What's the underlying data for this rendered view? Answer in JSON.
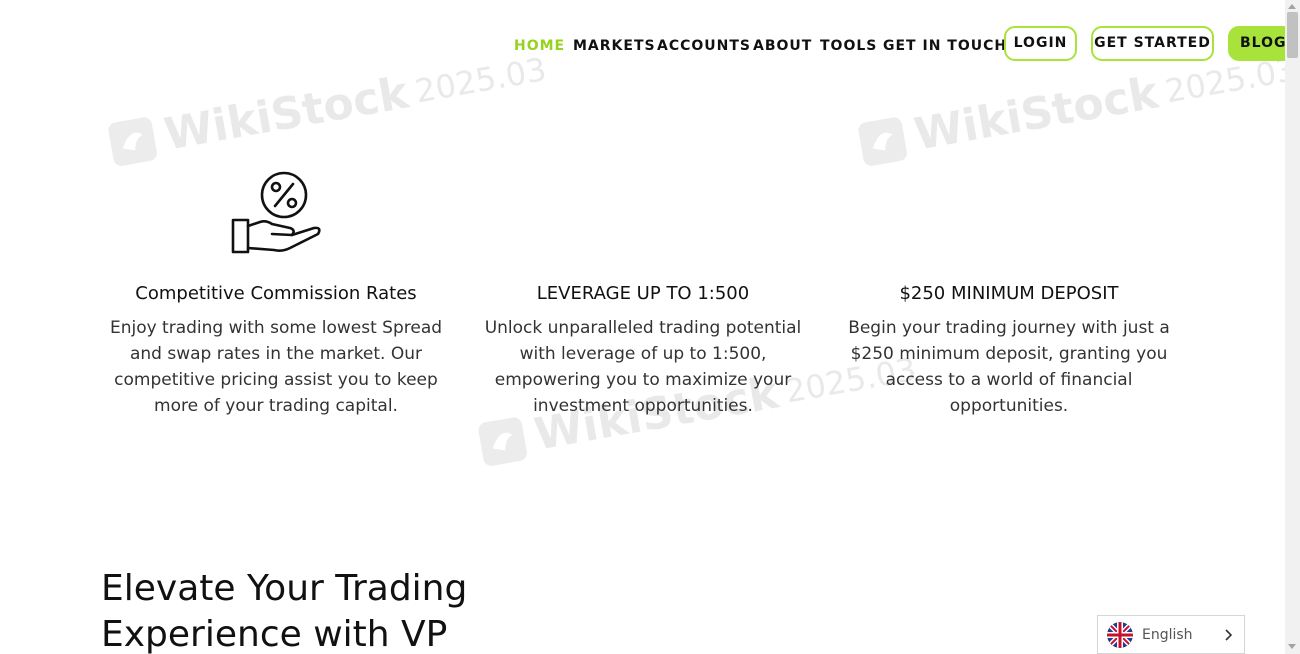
{
  "nav": {
    "links": [
      "HOME",
      "MARKETS",
      "ACCOUNTS",
      "ABOUT",
      "TOOLS",
      "GET IN TOUCH"
    ],
    "login": "LOGIN",
    "get_started": "GET STARTED",
    "blog": "BLOG"
  },
  "watermark": {
    "brand": "WikiStock",
    "version": "2025.03"
  },
  "features": [
    {
      "title": "Competitive Commission Rates",
      "text": "Enjoy trading with some lowest Spread and swap rates in the market. Our competitive pricing assist you to keep more of your trading capital."
    },
    {
      "title": "LEVERAGE UP TO 1:500",
      "text": "Unlock unparalleled trading potential with leverage of up to 1:500, empowering you to maximize your investment opportunities."
    },
    {
      "title": "$250 MINIMUM DEPOSIT",
      "text": "Begin your trading journey with just a $250 minimum deposit, granting you access to a world of financial opportunities."
    }
  ],
  "section_heading": "Elevate Your Trading Experience with VP",
  "language": {
    "label": "English"
  },
  "colors": {
    "accent": "#a7e33a",
    "active_link": "#96d21f"
  },
  "icons": {
    "feature_1": "hand-percent-icon",
    "language_flag": "uk-flag-icon",
    "language_chevron": "chevron-right-icon"
  }
}
